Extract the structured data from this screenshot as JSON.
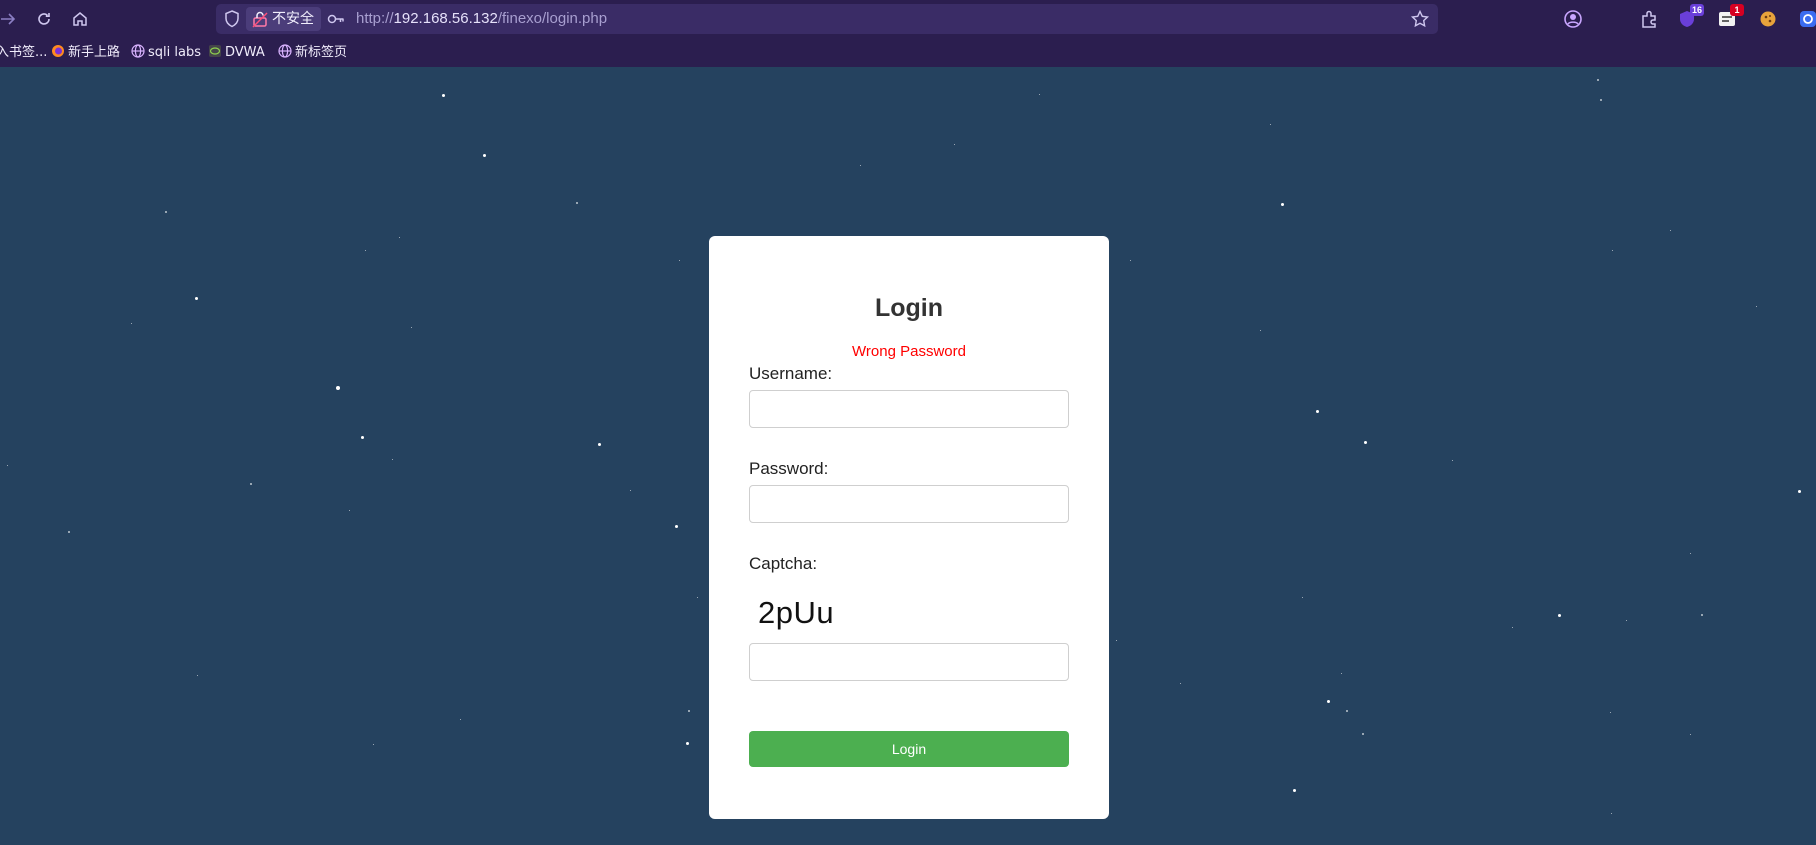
{
  "browser": {
    "security_label": "不安全",
    "url_scheme": "http://",
    "url_host": "192.168.56.132",
    "url_path": "/finexo/login.php",
    "extensions": [
      {
        "icon": "account-icon"
      },
      {
        "icon": "extensions-icon"
      },
      {
        "icon": "ublock-icon",
        "badge": "16",
        "badge_color": "#6a3fd9"
      },
      {
        "icon": "hackbar-icon",
        "badge": "1",
        "badge_color": "#d70022"
      },
      {
        "icon": "cookie-icon"
      },
      {
        "icon": "proxy-icon"
      }
    ]
  },
  "bookmarks": [
    {
      "label": "入书签...",
      "icon": "none"
    },
    {
      "label": "新手上路",
      "icon": "firefox-icon"
    },
    {
      "label": "sqli labs",
      "icon": "globe-icon"
    },
    {
      "label": "DVWA",
      "icon": "dvwa-icon"
    },
    {
      "label": "新标签页",
      "icon": "globe-icon"
    }
  ],
  "login": {
    "title": "Login",
    "error": "Wrong Password",
    "username_label": "Username:",
    "username_value": "",
    "password_label": "Password:",
    "password_value": "",
    "captcha_label": "Captcha:",
    "captcha_text": "2pUu",
    "captcha_value": "",
    "submit_label": "Login"
  },
  "colors": {
    "page_background": "#25425f",
    "error_text": "#ff0000",
    "button_bg": "#4caf50",
    "browser_chrome": "#2b1e4f"
  }
}
